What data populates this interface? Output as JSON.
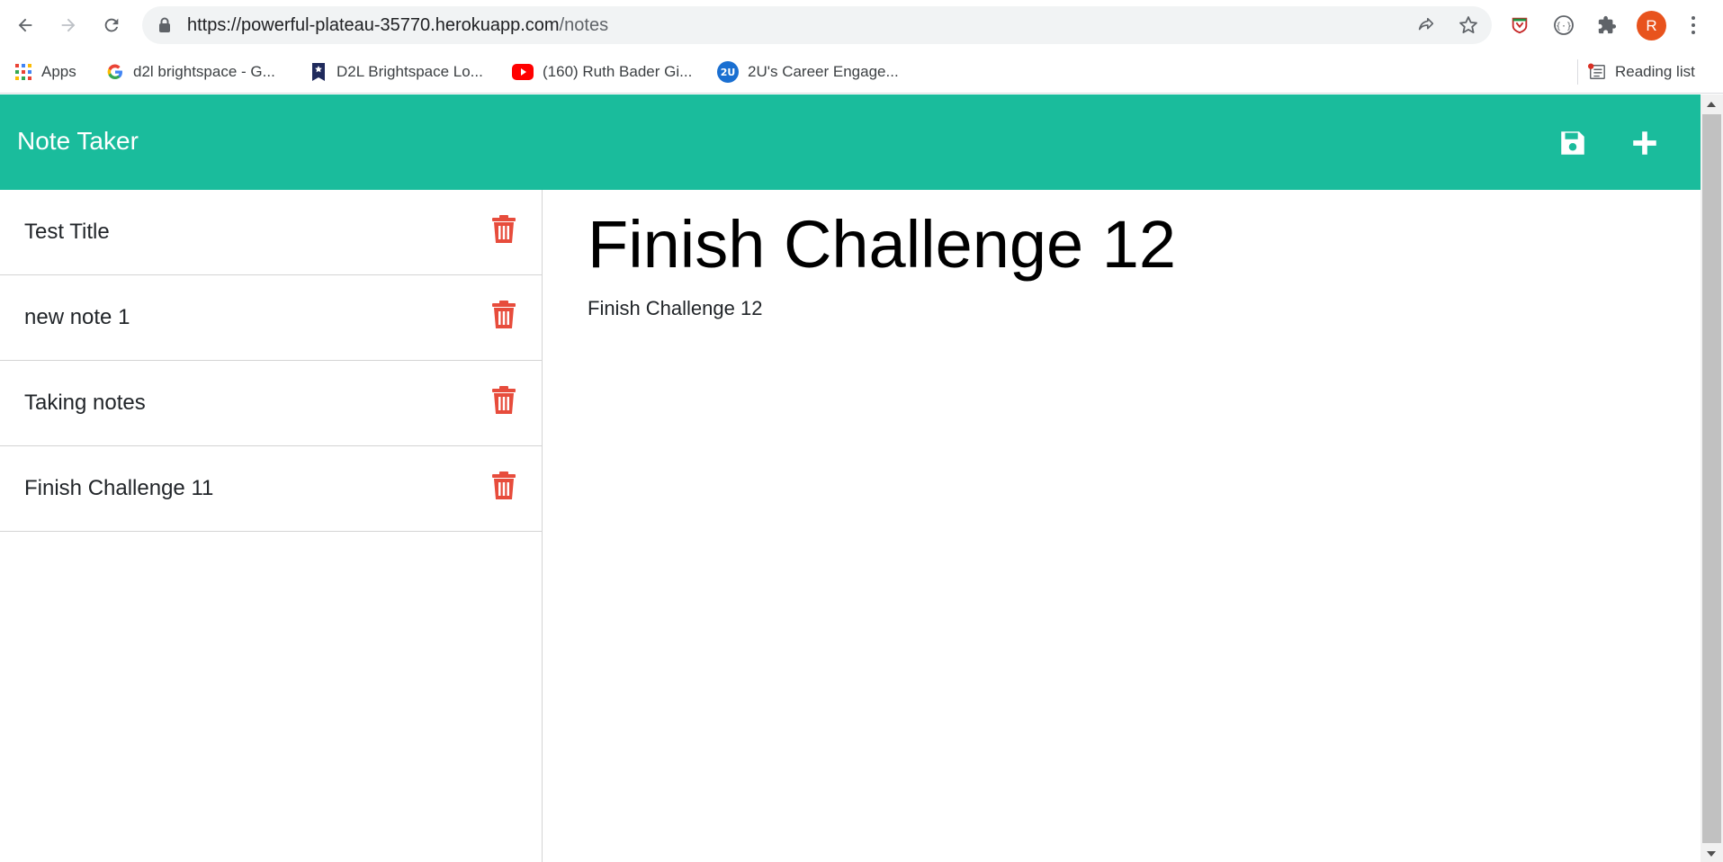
{
  "browser": {
    "url_host": "https://powerful-plateau-35770.herokuapp.com",
    "url_path": "/notes",
    "avatar_initial": "R",
    "bookmarks": [
      {
        "label": "Apps",
        "icon": "apps-grid-icon"
      },
      {
        "label": "d2l brightspace - G...",
        "icon": "google-icon"
      },
      {
        "label": "D2L Brightspace Lo...",
        "icon": "d2l-icon"
      },
      {
        "label": "(160) Ruth Bader Gi...",
        "icon": "youtube-icon"
      },
      {
        "label": "2U's Career Engage...",
        "icon": "2u-icon"
      }
    ],
    "reading_list_label": "Reading list"
  },
  "app": {
    "title": "Note Taker",
    "accent_color": "#1abc9c",
    "delete_color": "#e74c3c",
    "notes": [
      {
        "title": "Test Title"
      },
      {
        "title": "new note 1"
      },
      {
        "title": "Taking notes"
      },
      {
        "title": "Finish Challenge 11"
      }
    ],
    "active_note": {
      "title": "Finish Challenge 12",
      "text": "Finish Challenge 12"
    }
  }
}
